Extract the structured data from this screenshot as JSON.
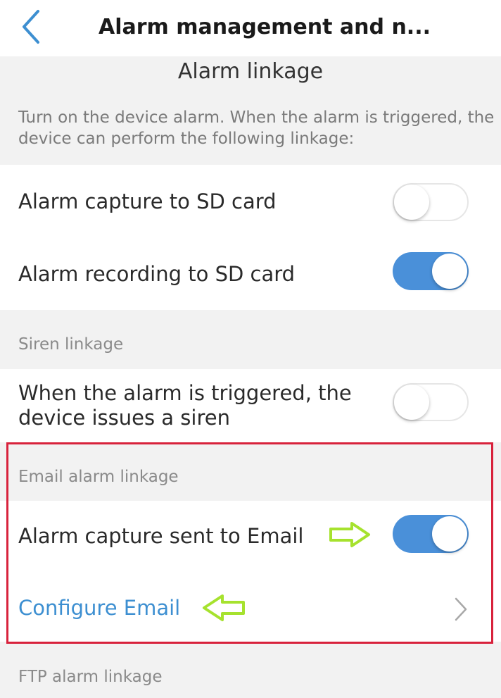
{
  "header": {
    "title": "Alarm management and n..."
  },
  "alarm_linkage": {
    "title": "Alarm linkage",
    "description": "Turn on the device alarm. When the alarm is triggered, the device can perform the following linkage:",
    "items": [
      {
        "label": "Alarm capture to SD card",
        "enabled": false
      },
      {
        "label": "Alarm recording to SD card",
        "enabled": true
      }
    ]
  },
  "siren_linkage": {
    "section_label": "Siren linkage",
    "item": {
      "label": "When the alarm is triggered, the device issues a siren",
      "enabled": false
    }
  },
  "email_linkage": {
    "section_label": "Email alarm linkage",
    "item": {
      "label": "Alarm capture sent to Email",
      "enabled": true
    },
    "configure_label": "Configure Email"
  },
  "ftp_linkage": {
    "section_label": "FTP alarm linkage"
  },
  "colors": {
    "toggle_on": "#4a90d9",
    "link": "#3d8fd1",
    "highlight_border": "#d8223c",
    "annotation_arrow": "#a6e22e"
  },
  "icons": {
    "back": "chevron-left-icon",
    "configure": "chevron-right-icon",
    "annotation": "outline-arrow-icon"
  }
}
